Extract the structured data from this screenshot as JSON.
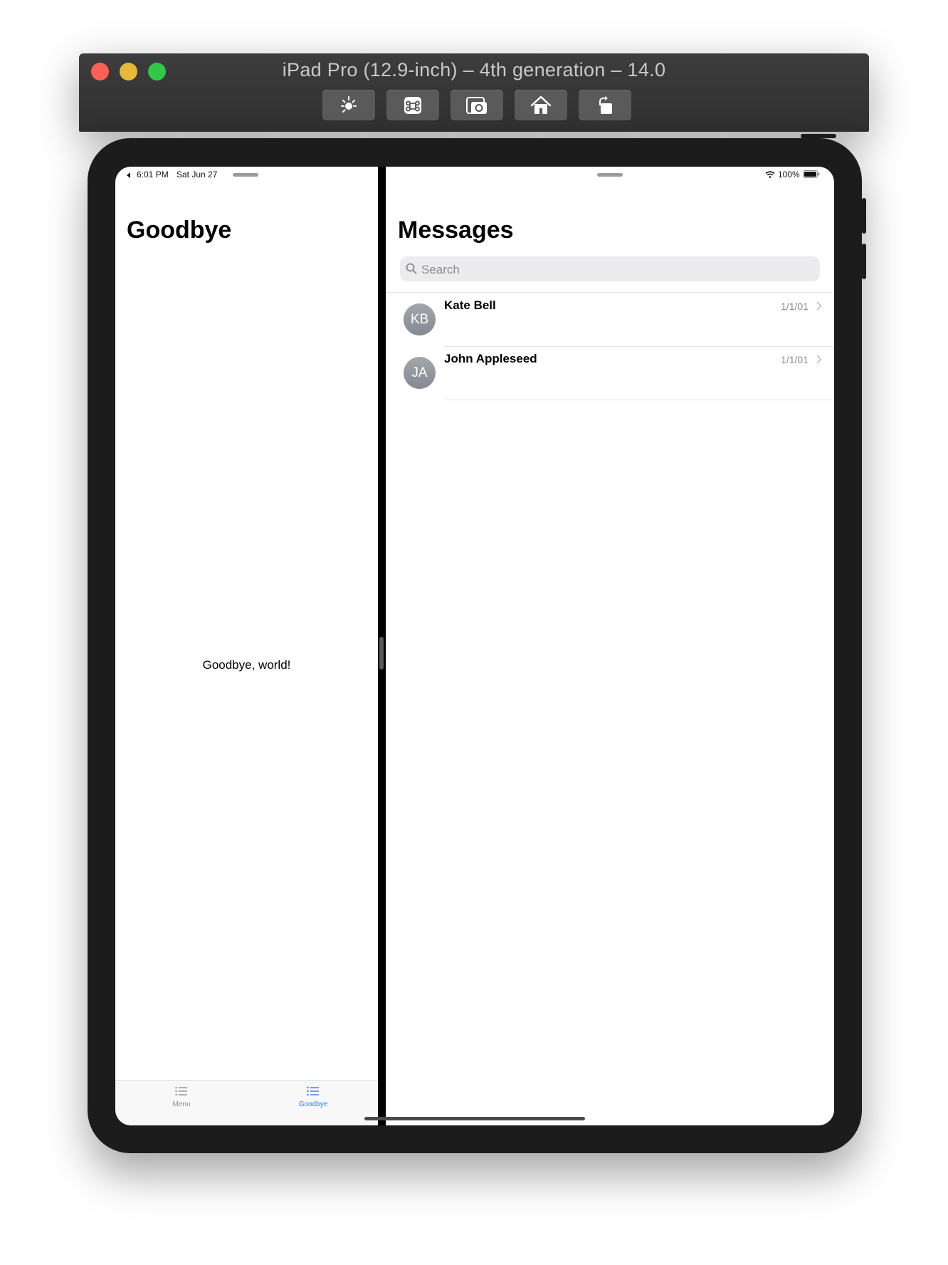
{
  "window": {
    "title": "iPad Pro (12.9-inch) – 4th generation – 14.0"
  },
  "toolbar_icons": [
    "brightness-icon",
    "command-icon",
    "screenshot-icon",
    "home-icon",
    "rotate-icon"
  ],
  "status_bar": {
    "time": "6:01 PM",
    "date": "Sat Jun 27",
    "battery": "100%"
  },
  "left_pane": {
    "title": "Goodbye",
    "body_text": "Goodbye, world!",
    "tabs": [
      {
        "label": "Menu",
        "icon": "list-icon",
        "selected": false
      },
      {
        "label": "Goodbye",
        "icon": "list-icon",
        "selected": true
      }
    ]
  },
  "right_pane": {
    "title": "Messages",
    "search": {
      "placeholder": "Search",
      "value": ""
    },
    "messages": [
      {
        "initials": "KB",
        "name": "Kate Bell",
        "date": "1/1/01"
      },
      {
        "initials": "JA",
        "name": "John Appleseed",
        "date": "1/1/01"
      }
    ]
  },
  "colors": {
    "accent": "#2f7cf6",
    "tab_inactive": "#8e8e93",
    "avatar": "#9a9ca4"
  }
}
